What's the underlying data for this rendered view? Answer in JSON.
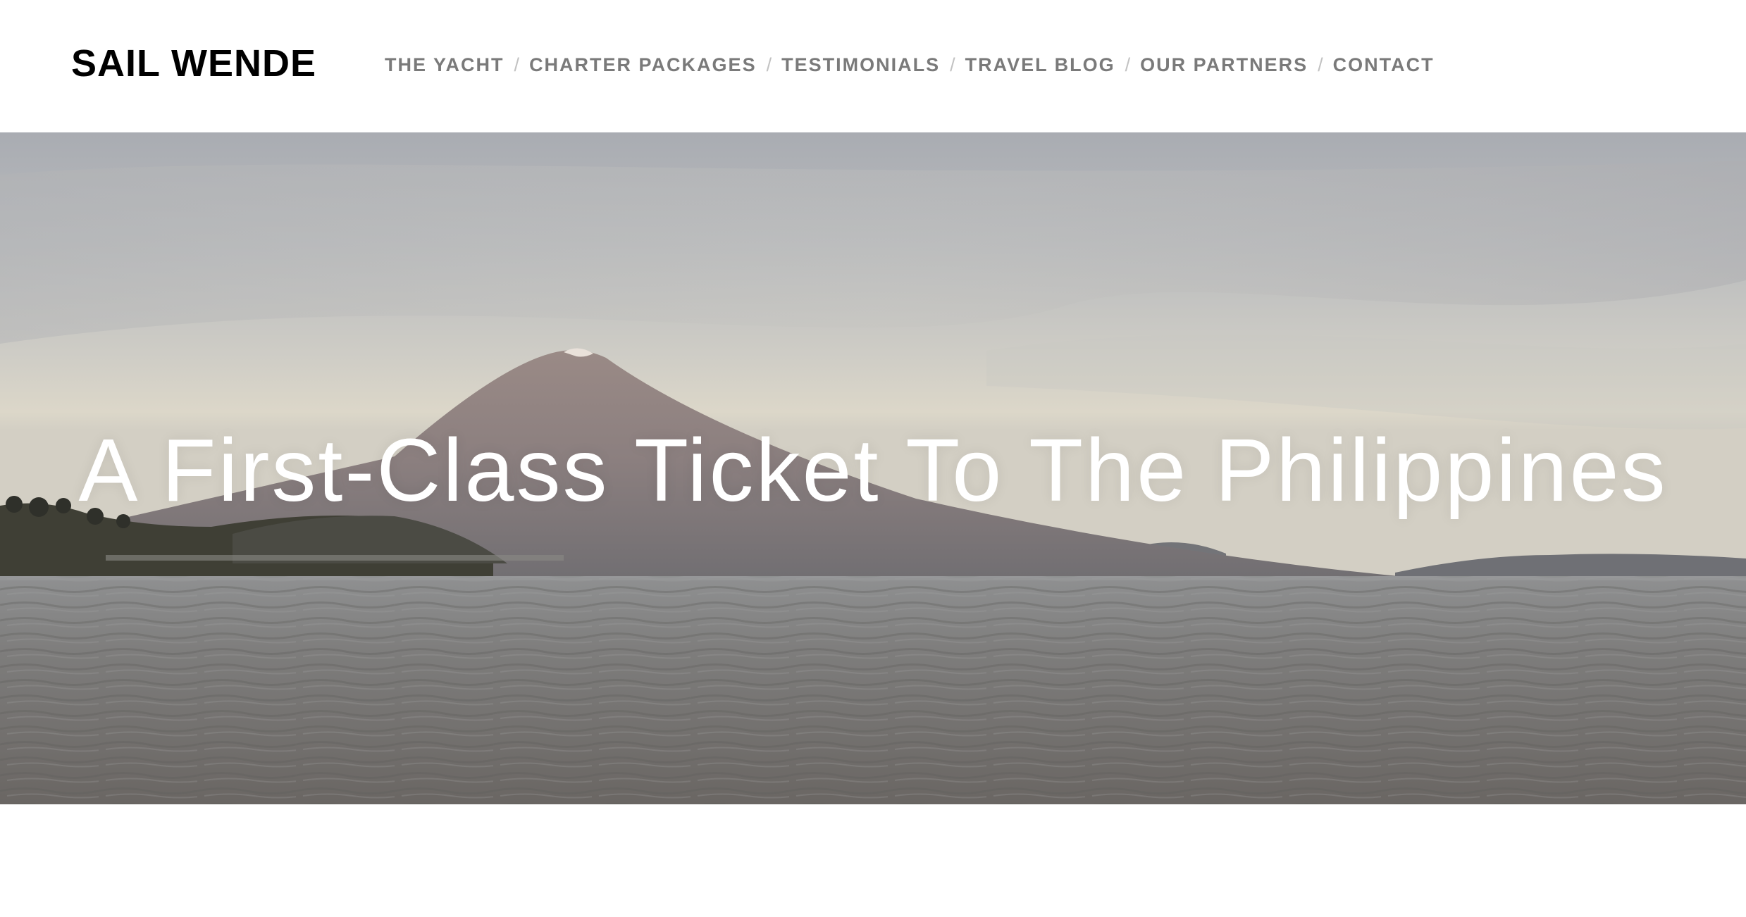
{
  "header": {
    "site_title": "SAIL WENDE",
    "nav": {
      "separator": "/",
      "items": [
        {
          "label": "THE YACHT"
        },
        {
          "label": "CHARTER PACKAGES"
        },
        {
          "label": "TESTIMONIALS"
        },
        {
          "label": "TRAVEL BLOG"
        },
        {
          "label": "OUR PARTNERS"
        },
        {
          "label": "CONTACT"
        }
      ]
    }
  },
  "hero": {
    "heading": "A First-Class Ticket To The Philippines",
    "image_subject": "volcano-over-bay-photo"
  },
  "colors": {
    "title": "#000000",
    "nav_link": "#7a7a7a",
    "nav_separator": "#c2c2c2",
    "hero_text": "#ffffff",
    "background": "#ffffff"
  }
}
